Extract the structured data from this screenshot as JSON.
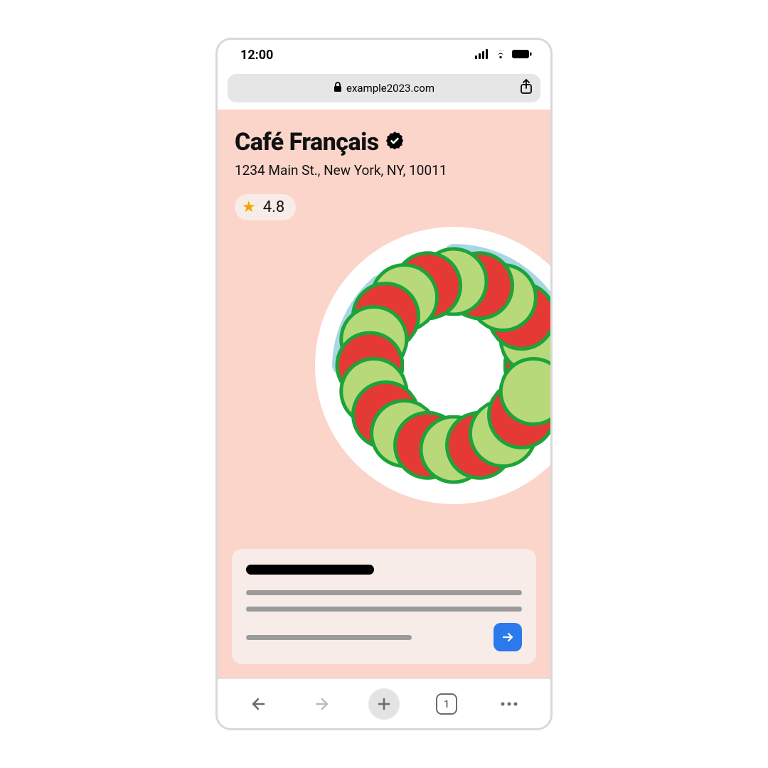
{
  "status": {
    "time": "12:00"
  },
  "address_bar": {
    "domain": "example2023.com"
  },
  "restaurant": {
    "name": "Café Français",
    "address": "1234 Main St., New York, NY, 10011",
    "rating": "4.8"
  },
  "bottom_nav": {
    "tab_count": "1"
  }
}
